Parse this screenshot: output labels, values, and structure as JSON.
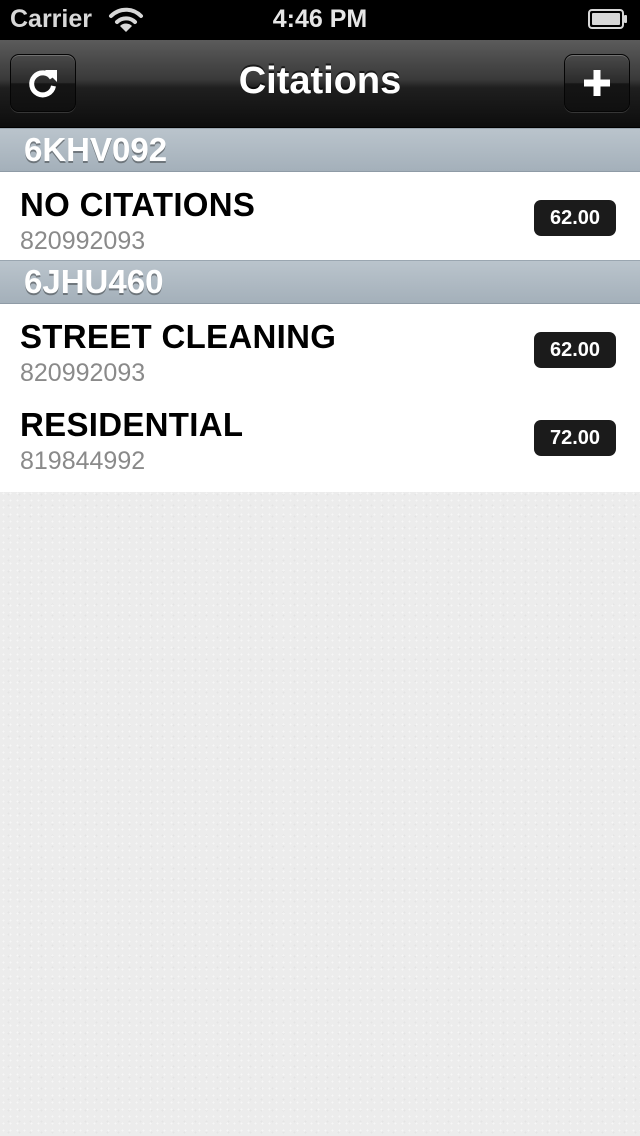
{
  "status_bar": {
    "carrier": "Carrier",
    "time": "4:46 PM"
  },
  "nav": {
    "title": "Citations",
    "left_button_icon": "refresh-icon",
    "right_button_icon": "plus-icon"
  },
  "sections": [
    {
      "header": "6KHV092",
      "rows": [
        {
          "title": "NO CITATIONS",
          "subtitle": "820992093",
          "amount": "62.00"
        }
      ]
    },
    {
      "header": "6JHU460",
      "rows": [
        {
          "title": "STREET CLEANING",
          "subtitle": "820992093",
          "amount": "62.00"
        },
        {
          "title": "RESIDENTIAL",
          "subtitle": "819844992",
          "amount": "72.00"
        }
      ]
    }
  ],
  "colors": {
    "nav_background": "#1f1f1f",
    "section_header": "#aeb8c2",
    "badge": "#1b1b1b",
    "paper_background": "#ececec"
  }
}
